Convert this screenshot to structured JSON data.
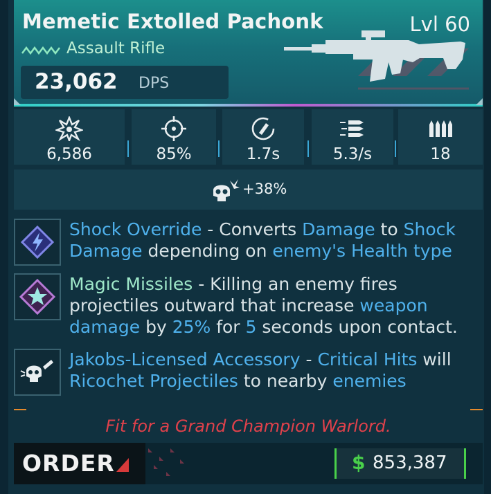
{
  "weapon": {
    "name": "Memetic Extolled Pachonk",
    "level": "Lvl 60",
    "type": "Assault Rifle",
    "dps_value": "23,062",
    "dps_unit": "DPS",
    "rarity_color": "#8fe8c0",
    "header_color": "#1c8f8c"
  },
  "stats": [
    {
      "icon": "damage-burst-icon",
      "value": "6,586"
    },
    {
      "icon": "crosshair-accuracy-icon",
      "value": "85%"
    },
    {
      "icon": "reload-time-icon",
      "value": "1.7s"
    },
    {
      "icon": "fire-rate-icon",
      "value": "5.3/s"
    },
    {
      "icon": "magazine-ammo-icon",
      "value": "18"
    }
  ],
  "bonus": {
    "icon": "crit-skull-icon",
    "value": "+38%"
  },
  "perks": [
    {
      "icon": "shock-lightning-icon",
      "segments": [
        {
          "t": "Shock Override",
          "c": "name-blue"
        },
        {
          "t": " - Converts ",
          "c": ""
        },
        {
          "t": "Damage",
          "c": "kw"
        },
        {
          "t": " to ",
          "c": ""
        },
        {
          "t": "Shock Damage",
          "c": "kw"
        },
        {
          "t": " depending on ",
          "c": ""
        },
        {
          "t": "enemy's Health type",
          "c": "kw"
        }
      ]
    },
    {
      "icon": "magic-star-icon",
      "segments": [
        {
          "t": "Magic Missiles",
          "c": "name-teal"
        },
        {
          "t": " - Killing an enemy fires projectiles outward that increase ",
          "c": ""
        },
        {
          "t": "weapon damage",
          "c": "kw"
        },
        {
          "t": " by ",
          "c": ""
        },
        {
          "t": "25%",
          "c": "kw"
        },
        {
          "t": " for ",
          "c": ""
        },
        {
          "t": "5",
          "c": "kw"
        },
        {
          "t": " seconds upon contact.",
          "c": ""
        }
      ]
    },
    {
      "icon": "skull-ricochet-icon",
      "segments": [
        {
          "t": "Jakobs-Licensed Accessory",
          "c": "name-orange"
        },
        {
          "t": " - ",
          "c": ""
        },
        {
          "t": "Critical Hits",
          "c": "kw"
        },
        {
          "t": " will ",
          "c": ""
        },
        {
          "t": "Ricochet Projectiles",
          "c": "kw"
        },
        {
          "t": " to nearby ",
          "c": ""
        },
        {
          "t": "enemies",
          "c": "kw"
        }
      ]
    }
  ],
  "flair_text": "Fit for a Grand Champion Warlord.",
  "manufacturer": "ORDER",
  "price": {
    "symbol": "$",
    "value": "853,387",
    "color": "#49d04a"
  }
}
